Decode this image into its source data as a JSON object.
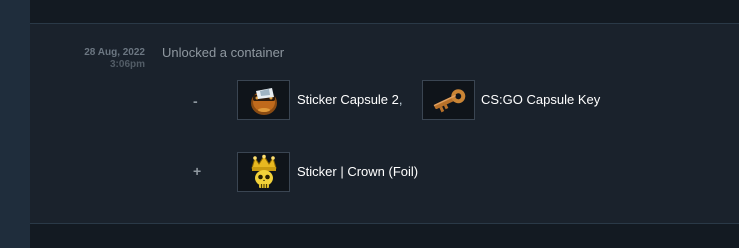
{
  "history": {
    "date": "28 Aug, 2022",
    "time": "3:06pm",
    "event": "Unlocked a container",
    "removed": {
      "sign": "-",
      "items": [
        {
          "name": "Sticker Capsule 2",
          "separator": ",",
          "icon": "sticker-capsule-icon"
        },
        {
          "name": "CS:GO Capsule Key",
          "icon": "capsule-key-icon"
        }
      ]
    },
    "added": {
      "sign": "+",
      "items": [
        {
          "name": "Sticker | Crown (Foil)",
          "icon": "crown-sticker-icon"
        }
      ]
    }
  }
}
